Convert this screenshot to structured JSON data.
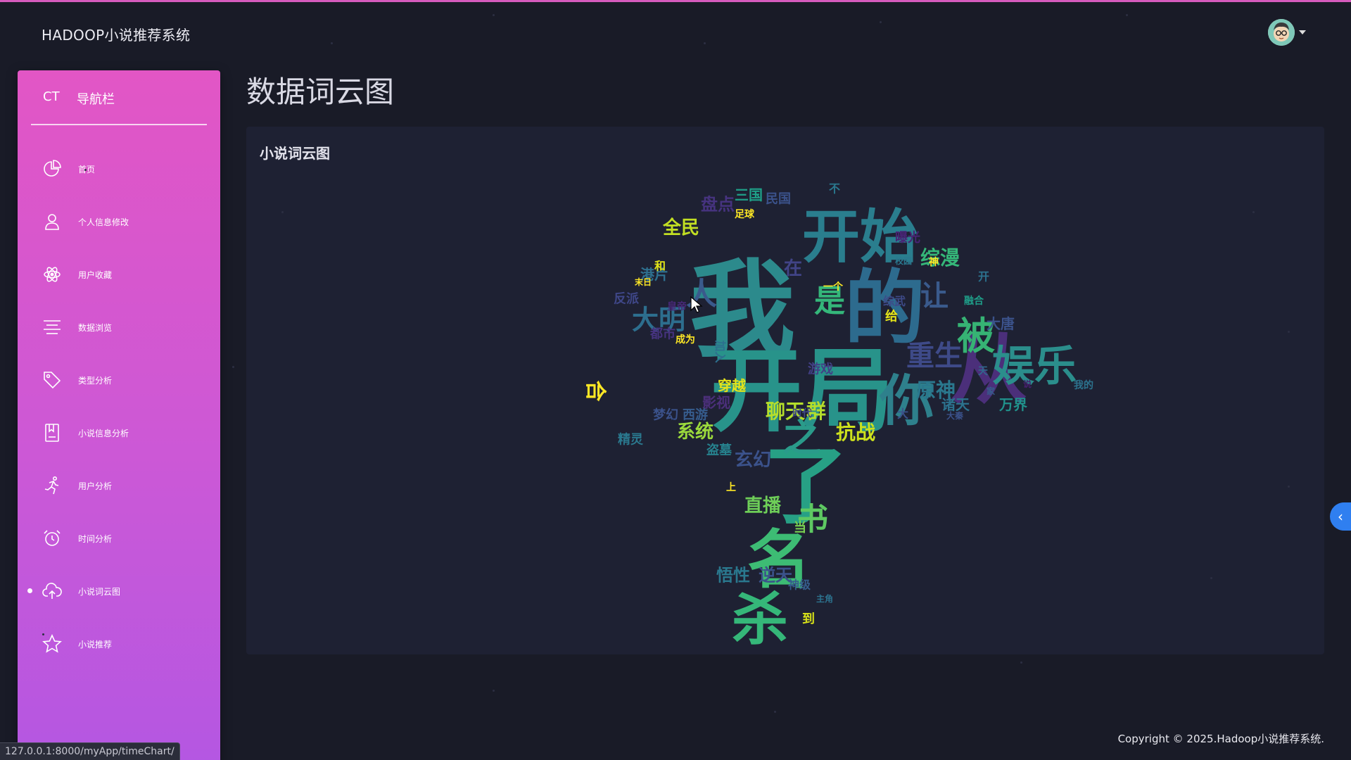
{
  "app": {
    "brand": "HADOOP小说推荐系统",
    "page_title": "数据词云图"
  },
  "sidebar": {
    "short": "CT",
    "title": "导航栏",
    "items": [
      {
        "label": "首页",
        "icon": "pie-chart-icon",
        "active": false
      },
      {
        "label": "个人信息修改",
        "icon": "user-icon",
        "active": false
      },
      {
        "label": "用户收藏",
        "icon": "atom-icon",
        "active": false
      },
      {
        "label": "数据浏览",
        "icon": "align-center-icon",
        "active": false
      },
      {
        "label": "类型分析",
        "icon": "tag-icon",
        "active": false
      },
      {
        "label": "小说信息分析",
        "icon": "book-icon",
        "active": false
      },
      {
        "label": "用户分析",
        "icon": "running-person-icon",
        "active": false
      },
      {
        "label": "时间分析",
        "icon": "alarm-clock-icon",
        "active": false
      },
      {
        "label": "小说词云图",
        "icon": "cloud-upload-icon",
        "active": true
      },
      {
        "label": "小说推荐",
        "icon": "star-icon",
        "active": false
      }
    ]
  },
  "card": {
    "title": "小说词云图"
  },
  "wordcloud": {
    "words": [
      {
        "text": "我",
        "color": "#2c8a8c"
      },
      {
        "text": "开始",
        "color": "#2a7e8e"
      },
      {
        "text": "的",
        "color": "#2d6b8e"
      },
      {
        "text": "开局",
        "color": "#28938a"
      },
      {
        "text": "从",
        "color": "#4b2f7a"
      },
      {
        "text": "了",
        "color": "#27a085"
      },
      {
        "text": "你",
        "color": "#2e808c"
      },
      {
        "text": "娱乐",
        "color": "#2b8e8c"
      },
      {
        "text": "被",
        "color": "#36b374"
      },
      {
        "text": "重生",
        "color": "#3e4a88"
      },
      {
        "text": "大明",
        "color": "#2d6e8e"
      },
      {
        "text": "人",
        "color": "#3a5a8c"
      },
      {
        "text": "让",
        "color": "#3a5a8c"
      },
      {
        "text": "是",
        "color": "#34b77a"
      },
      {
        "text": "之",
        "color": "#2a9b8a"
      },
      {
        "text": "全民",
        "color": "#c2df23"
      },
      {
        "text": "盘点",
        "color": "#46337f"
      },
      {
        "text": "综漫",
        "color": "#35b779"
      },
      {
        "text": "原神",
        "color": "#2a788e"
      },
      {
        "text": "聊天",
        "color": "#b5de2b"
      },
      {
        "text": "群",
        "color": "#b5de2b"
      },
      {
        "text": "抗战",
        "color": "#cde11d"
      },
      {
        "text": "系统",
        "color": "#9bd93c"
      },
      {
        "text": "玄幻",
        "color": "#3b528b"
      },
      {
        "text": "直播",
        "color": "#6ece58"
      },
      {
        "text": "书",
        "color": "#5ec962"
      },
      {
        "text": "名",
        "color": "#3dbc74"
      },
      {
        "text": "杀",
        "color": "#35b779"
      },
      {
        "text": "悟性",
        "color": "#2a788e"
      },
      {
        "text": "逆天",
        "color": "#3b528b"
      },
      {
        "text": "诸天",
        "color": "#2c728e"
      },
      {
        "text": "万界",
        "color": "#20928c"
      },
      {
        "text": "穿越",
        "color": "#e5e419"
      },
      {
        "text": "影视",
        "color": "#4b2f7a"
      },
      {
        "text": "梦幻",
        "color": "#3b528b"
      },
      {
        "text": "西游",
        "color": "#365c8d"
      },
      {
        "text": "港片",
        "color": "#2e6f8e"
      },
      {
        "text": "反派",
        "color": "#3f4788"
      },
      {
        "text": "都市",
        "color": "#46337f"
      },
      {
        "text": "游戏",
        "color": "#424086"
      },
      {
        "text": "民国",
        "color": "#3b528b"
      },
      {
        "text": "三国",
        "color": "#1fa088"
      },
      {
        "text": "足球",
        "color": "#fde725"
      },
      {
        "text": "曝光",
        "color": "#482475"
      },
      {
        "text": "时代",
        "color": "#3e4989"
      },
      {
        "text": "精灵",
        "color": "#2a788e"
      },
      {
        "text": "盗墓",
        "color": "#26828e"
      },
      {
        "text": "神级",
        "color": "#365d8d"
      },
      {
        "text": "合",
        "color": "#fde725"
      },
      {
        "text": "和",
        "color": "#e2e418"
      },
      {
        "text": "在",
        "color": "#414487"
      },
      {
        "text": "大唐",
        "color": "#3b528b"
      },
      {
        "text": "给",
        "color": "#e5e419"
      },
      {
        "text": "当",
        "color": "#7ad151"
      },
      {
        "text": "到",
        "color": "#d8e219"
      },
      {
        "text": "上",
        "color": "#fde725"
      },
      {
        "text": "融合",
        "color": "#1f9e89"
      },
      {
        "text": "综武",
        "color": "#3e4a89"
      },
      {
        "text": "加入",
        "color": "#2d708e"
      },
      {
        "text": "成为",
        "color": "#fde725"
      },
      {
        "text": "皇帝",
        "color": "#482878"
      },
      {
        "text": "不",
        "color": "#2a788e"
      },
      {
        "text": "一个",
        "color": "#fde725"
      },
      {
        "text": "末日",
        "color": "#fde725"
      },
      {
        "text": "主角",
        "color": "#2c728e"
      },
      {
        "text": "天",
        "color": "#31688e"
      },
      {
        "text": "开",
        "color": "#2c728e"
      },
      {
        "text": "大",
        "color": "#3b528b"
      },
      {
        "text": "我的",
        "color": "#2c738e"
      },
      {
        "text": "神",
        "color": "#fde725"
      },
      {
        "text": "校园",
        "color": "#2a788e"
      },
      {
        "text": "大秦",
        "color": "#3b528b"
      },
      {
        "text": "说",
        "color": "#481f70"
      },
      {
        "text": "家",
        "color": "#355f8d"
      }
    ]
  },
  "footer": {
    "copyright": "Copyright © 2025.Hadoop小说推荐系统."
  },
  "statusbar": {
    "url": "127.0.0.1:8000/myApp/timeChart/"
  },
  "toggle": {
    "glyph": "‹"
  }
}
